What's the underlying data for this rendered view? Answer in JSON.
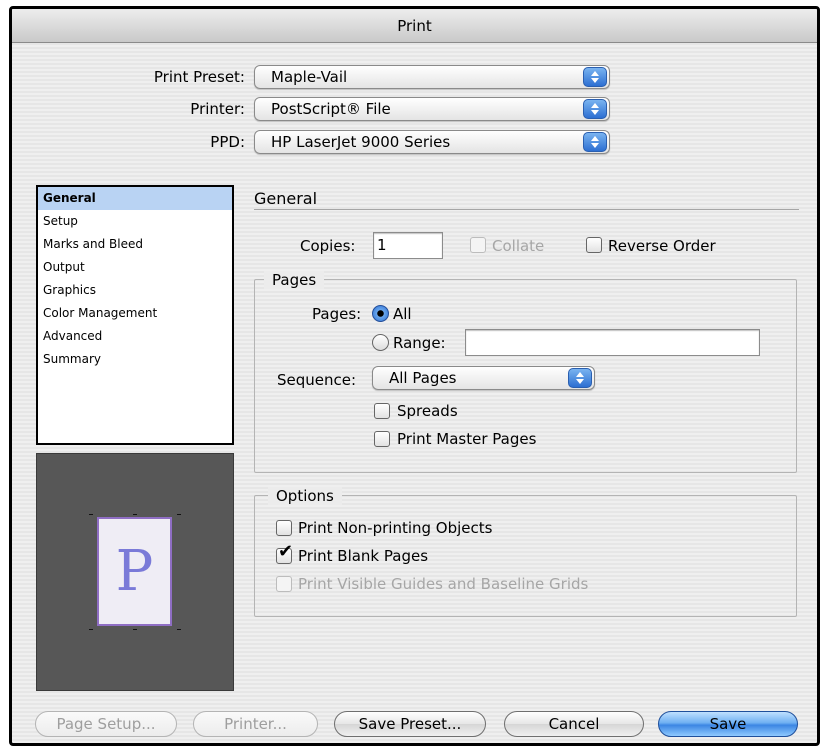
{
  "window": {
    "title": "Print"
  },
  "header": {
    "preset_label": "Print Preset:",
    "preset_value": "Maple-Vail",
    "printer_label": "Printer:",
    "printer_value": "PostScript® File",
    "ppd_label": "PPD:",
    "ppd_value": "HP LaserJet 9000 Series"
  },
  "sidebar": {
    "items": [
      {
        "label": "General",
        "selected": true
      },
      {
        "label": "Setup"
      },
      {
        "label": "Marks and Bleed"
      },
      {
        "label": "Output"
      },
      {
        "label": "Graphics"
      },
      {
        "label": "Color Management"
      },
      {
        "label": "Advanced"
      },
      {
        "label": "Summary"
      }
    ]
  },
  "preview": {
    "page_glyph": "P"
  },
  "general": {
    "section_title": "General",
    "copies_label": "Copies:",
    "copies_value": "1",
    "collate_label": "Collate",
    "collate_checked": false,
    "collate_enabled": false,
    "reverse_label": "Reverse Order",
    "reverse_checked": false
  },
  "pages": {
    "group_label": "Pages",
    "pages_label": "Pages:",
    "all_label": "All",
    "all_selected": true,
    "range_label": "Range:",
    "range_value": "",
    "sequence_label": "Sequence:",
    "sequence_value": "All Pages",
    "spreads_label": "Spreads",
    "spreads_checked": false,
    "master_label": "Print Master Pages",
    "master_checked": false
  },
  "options": {
    "group_label": "Options",
    "nonprinting_label": "Print Non-printing Objects",
    "nonprinting_checked": false,
    "blank_label": "Print Blank Pages",
    "blank_checked": true,
    "guides_label": "Print Visible Guides and Baseline Grids",
    "guides_enabled": false
  },
  "footer": {
    "page_setup": "Page Setup...",
    "printer": "Printer...",
    "save_preset": "Save Preset...",
    "cancel": "Cancel",
    "save": "Save"
  },
  "icons": {
    "checkmark": "checkmark-icon",
    "popup_arrows": "updown-arrows-icon"
  },
  "colors": {
    "accent": "#3c86e3",
    "sidebar_selection": "#b9d3f3"
  }
}
